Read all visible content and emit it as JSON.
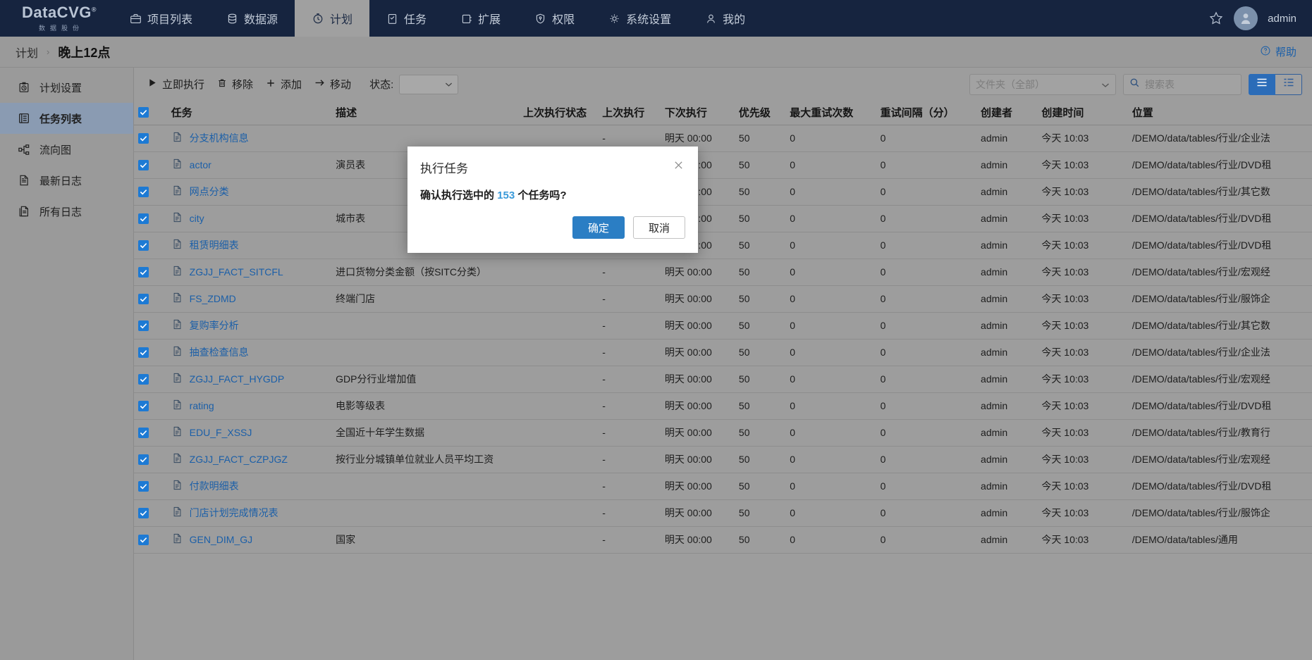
{
  "topnav": {
    "brand": {
      "name": "DataCVG",
      "registered": "®",
      "sub": "数据股份"
    },
    "items": [
      {
        "label": "项目列表",
        "icon": "briefcase-icon",
        "active": false
      },
      {
        "label": "数据源",
        "icon": "database-icon",
        "active": false
      },
      {
        "label": "计划",
        "icon": "clock-icon",
        "active": true
      },
      {
        "label": "任务",
        "icon": "clipboard-check-icon",
        "active": false
      },
      {
        "label": "扩展",
        "icon": "plugin-icon",
        "active": false
      },
      {
        "label": "权限",
        "icon": "shield-icon",
        "active": false
      },
      {
        "label": "系统设置",
        "icon": "gear-icon",
        "active": false
      },
      {
        "label": "我的",
        "icon": "user-icon",
        "active": false
      }
    ],
    "star_icon": "star-icon",
    "avatar_icon": "avatar-icon",
    "username": "admin"
  },
  "breadcrumb": {
    "root": "计划",
    "separator": "›",
    "current": "晚上12点",
    "help_label": "帮助",
    "help_icon": "question-circle-icon"
  },
  "sidebar": {
    "items": [
      {
        "label": "计划设置",
        "icon": "schedule-settings-icon",
        "active": false
      },
      {
        "label": "任务列表",
        "icon": "task-list-icon",
        "active": true
      },
      {
        "label": "流向图",
        "icon": "flow-diagram-icon",
        "active": false
      },
      {
        "label": "最新日志",
        "icon": "document-icon",
        "active": false
      },
      {
        "label": "所有日志",
        "icon": "documents-icon",
        "active": false
      }
    ]
  },
  "toolbar": {
    "run_now": "立即执行",
    "run_now_icon": "play-icon",
    "remove": "移除",
    "remove_icon": "trash-icon",
    "add": "添加",
    "add_icon": "plus-icon",
    "move": "移动",
    "move_icon": "arrow-right-icon",
    "status_label": "状态:",
    "status_value": "",
    "folder_value": "文件夹（全部）",
    "search_placeholder": "搜索表",
    "search_value": "",
    "search_icon": "search-icon",
    "view_list_icon": "list-view-icon",
    "view_detail_icon": "detail-view-icon"
  },
  "table": {
    "columns": [
      "任务",
      "描述",
      "上次执行状态",
      "上次执行",
      "下次执行",
      "优先级",
      "最大重试次数",
      "重试间隔（分）",
      "创建者",
      "创建时间",
      "位置"
    ],
    "header_checked": true,
    "rows": [
      {
        "checked": true,
        "task": "分支机构信息",
        "desc": "",
        "last_status": "",
        "last_run": "-",
        "next_run": "明天 00:00",
        "priority": "50",
        "max_retry": "0",
        "interval": "0",
        "creator": "admin",
        "ctime": "今天 10:03",
        "location": "/DEMO/data/tables/行业/企业法"
      },
      {
        "checked": true,
        "task": "actor",
        "desc": "演员表",
        "last_status": "",
        "last_run": "-",
        "next_run": "明天 00:00",
        "priority": "50",
        "max_retry": "0",
        "interval": "0",
        "creator": "admin",
        "ctime": "今天 10:03",
        "location": "/DEMO/data/tables/行业/DVD租"
      },
      {
        "checked": true,
        "task": "网点分类",
        "desc": "",
        "last_status": "",
        "last_run": "-",
        "next_run": "明天 00:00",
        "priority": "50",
        "max_retry": "0",
        "interval": "0",
        "creator": "admin",
        "ctime": "今天 10:03",
        "location": "/DEMO/data/tables/行业/其它数"
      },
      {
        "checked": true,
        "task": "city",
        "desc": "城市表",
        "last_status": "",
        "last_run": "-",
        "next_run": "明天 00:00",
        "priority": "50",
        "max_retry": "0",
        "interval": "0",
        "creator": "admin",
        "ctime": "今天 10:03",
        "location": "/DEMO/data/tables/行业/DVD租"
      },
      {
        "checked": true,
        "task": "租赁明细表",
        "desc": "",
        "last_status": "",
        "last_run": "-",
        "next_run": "明天 00:00",
        "priority": "50",
        "max_retry": "0",
        "interval": "0",
        "creator": "admin",
        "ctime": "今天 10:03",
        "location": "/DEMO/data/tables/行业/DVD租"
      },
      {
        "checked": true,
        "task": "ZGJJ_FACT_SITCFL",
        "desc": "进口货物分类金额（按SITC分类）",
        "last_status": "",
        "last_run": "-",
        "next_run": "明天 00:00",
        "priority": "50",
        "max_retry": "0",
        "interval": "0",
        "creator": "admin",
        "ctime": "今天 10:03",
        "location": "/DEMO/data/tables/行业/宏观经"
      },
      {
        "checked": true,
        "task": "FS_ZDMD",
        "desc": "终端门店",
        "last_status": "",
        "last_run": "-",
        "next_run": "明天 00:00",
        "priority": "50",
        "max_retry": "0",
        "interval": "0",
        "creator": "admin",
        "ctime": "今天 10:03",
        "location": "/DEMO/data/tables/行业/服饰企"
      },
      {
        "checked": true,
        "task": "复购率分析",
        "desc": "",
        "last_status": "",
        "last_run": "-",
        "next_run": "明天 00:00",
        "priority": "50",
        "max_retry": "0",
        "interval": "0",
        "creator": "admin",
        "ctime": "今天 10:03",
        "location": "/DEMO/data/tables/行业/其它数"
      },
      {
        "checked": true,
        "task": "抽查检查信息",
        "desc": "",
        "last_status": "",
        "last_run": "-",
        "next_run": "明天 00:00",
        "priority": "50",
        "max_retry": "0",
        "interval": "0",
        "creator": "admin",
        "ctime": "今天 10:03",
        "location": "/DEMO/data/tables/行业/企业法"
      },
      {
        "checked": true,
        "task": "ZGJJ_FACT_HYGDP",
        "desc": "GDP分行业增加值",
        "last_status": "",
        "last_run": "-",
        "next_run": "明天 00:00",
        "priority": "50",
        "max_retry": "0",
        "interval": "0",
        "creator": "admin",
        "ctime": "今天 10:03",
        "location": "/DEMO/data/tables/行业/宏观经"
      },
      {
        "checked": true,
        "task": "rating",
        "desc": "电影等级表",
        "last_status": "",
        "last_run": "-",
        "next_run": "明天 00:00",
        "priority": "50",
        "max_retry": "0",
        "interval": "0",
        "creator": "admin",
        "ctime": "今天 10:03",
        "location": "/DEMO/data/tables/行业/DVD租"
      },
      {
        "checked": true,
        "task": "EDU_F_XSSJ",
        "desc": "全国近十年学生数据",
        "last_status": "",
        "last_run": "-",
        "next_run": "明天 00:00",
        "priority": "50",
        "max_retry": "0",
        "interval": "0",
        "creator": "admin",
        "ctime": "今天 10:03",
        "location": "/DEMO/data/tables/行业/教育行"
      },
      {
        "checked": true,
        "task": "ZGJJ_FACT_CZPJGZ",
        "desc": "按行业分城镇单位就业人员平均工资",
        "last_status": "",
        "last_run": "-",
        "next_run": "明天 00:00",
        "priority": "50",
        "max_retry": "0",
        "interval": "0",
        "creator": "admin",
        "ctime": "今天 10:03",
        "location": "/DEMO/data/tables/行业/宏观经"
      },
      {
        "checked": true,
        "task": "付款明细表",
        "desc": "",
        "last_status": "",
        "last_run": "-",
        "next_run": "明天 00:00",
        "priority": "50",
        "max_retry": "0",
        "interval": "0",
        "creator": "admin",
        "ctime": "今天 10:03",
        "location": "/DEMO/data/tables/行业/DVD租"
      },
      {
        "checked": true,
        "task": "门店计划完成情况表",
        "desc": "",
        "last_status": "",
        "last_run": "-",
        "next_run": "明天 00:00",
        "priority": "50",
        "max_retry": "0",
        "interval": "0",
        "creator": "admin",
        "ctime": "今天 10:03",
        "location": "/DEMO/data/tables/行业/服饰企"
      },
      {
        "checked": true,
        "task": "GEN_DIM_GJ",
        "desc": "国家",
        "last_status": "",
        "last_run": "-",
        "next_run": "明天 00:00",
        "priority": "50",
        "max_retry": "0",
        "interval": "0",
        "creator": "admin",
        "ctime": "今天 10:03",
        "location": "/DEMO/data/tables/通用"
      }
    ]
  },
  "modal": {
    "title": "执行任务",
    "close_icon": "close-icon",
    "message_prefix": "确认执行选中的",
    "count": "153",
    "message_suffix": "个任务吗?",
    "confirm": "确定",
    "cancel": "取消"
  },
  "colors": {
    "nav_bg": "#16243f",
    "accent_blue": "#2b7ec4",
    "link_blue": "#1b5fa8",
    "count_blue": "#3a9ad9",
    "page_bg": "#9a9a9a",
    "sidebar_active": "#8a9bb2"
  }
}
